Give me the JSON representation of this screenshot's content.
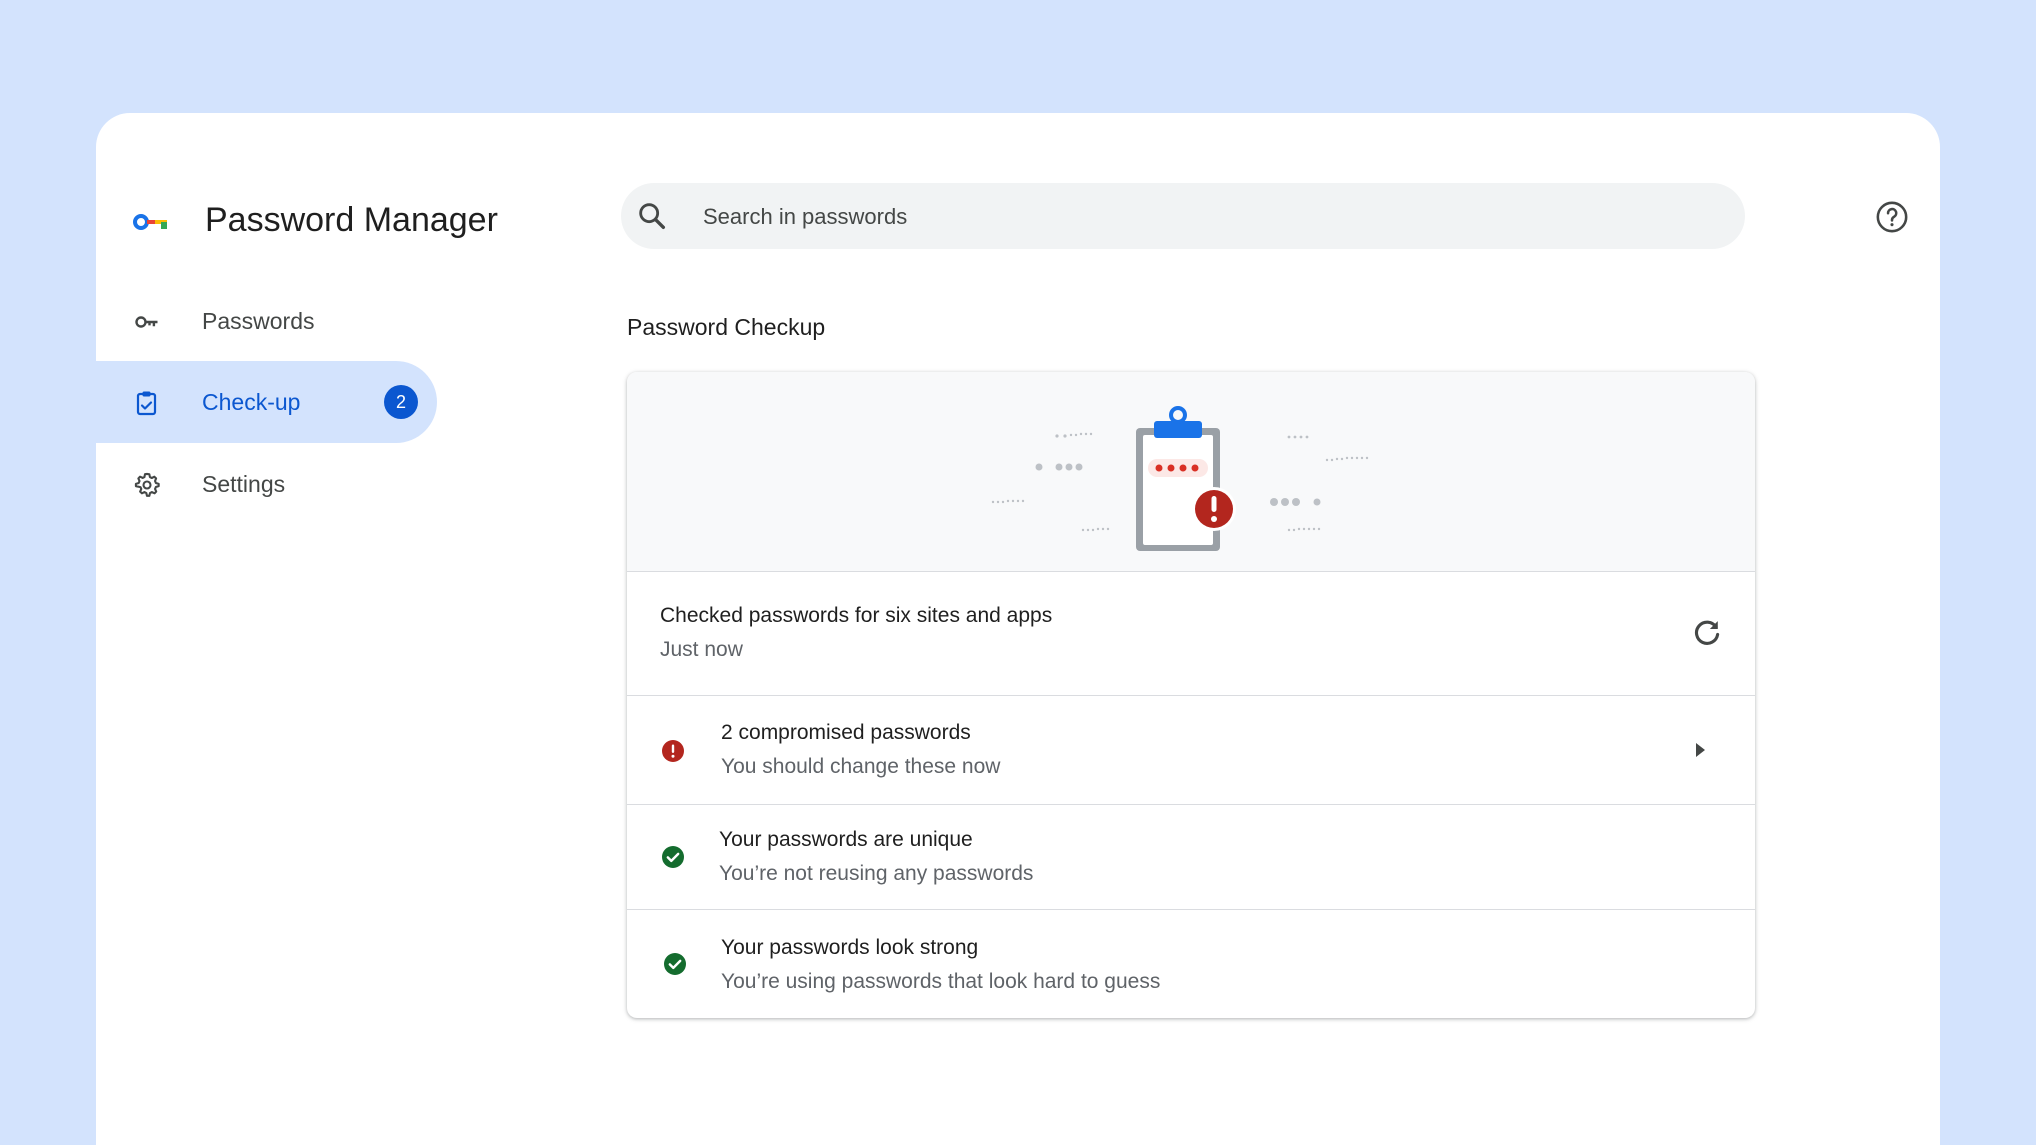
{
  "app": {
    "title": "Password Manager",
    "accent": "#0b57d0",
    "background": "#d3e3fd"
  },
  "search": {
    "placeholder": "Search in passwords"
  },
  "sidebar": {
    "items": [
      {
        "label": "Passwords",
        "icon": "key-icon",
        "active": false
      },
      {
        "label": "Check-up",
        "icon": "clipboard-check-icon",
        "active": true,
        "badge": "2"
      },
      {
        "label": "Settings",
        "icon": "gear-icon",
        "active": false
      }
    ]
  },
  "main": {
    "section_title": "Password Checkup",
    "status": {
      "title": "Checked passwords for six sites and apps",
      "subtitle": "Just now"
    },
    "checks": [
      {
        "title": "2 compromised passwords",
        "subtitle": "You should change these now",
        "icon": "error-icon",
        "color": "#b3261e"
      },
      {
        "title": "Your passwords are unique",
        "subtitle": "You’re not reusing any passwords",
        "icon": "check-circle-icon",
        "color": "#146c2e"
      },
      {
        "title": "Your passwords look strong",
        "subtitle": "You’re using passwords that look hard to guess",
        "icon": "check-circle-icon",
        "color": "#146c2e"
      }
    ]
  }
}
